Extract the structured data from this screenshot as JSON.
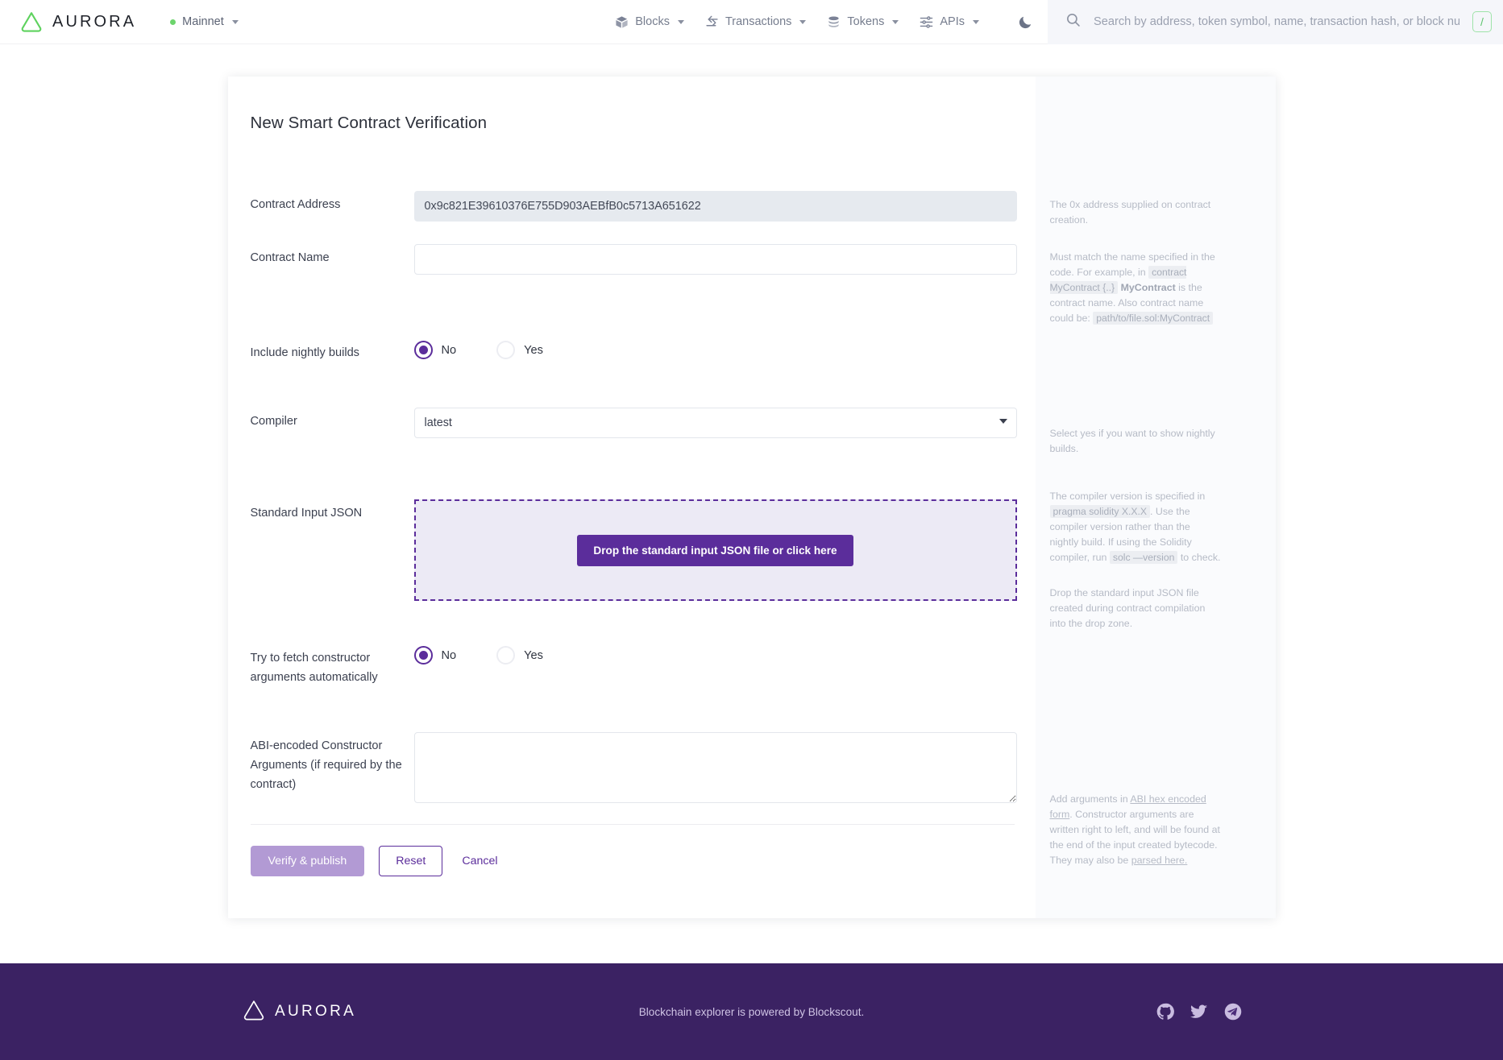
{
  "header": {
    "brand_name": "AURORA",
    "network": {
      "label": "Mainnet",
      "status_color": "#6cd46c"
    },
    "nav": [
      {
        "label": "Blocks",
        "icon": "cube-icon"
      },
      {
        "label": "Transactions",
        "icon": "transfer-arrows-icon"
      },
      {
        "label": "Tokens",
        "icon": "coins-icon"
      },
      {
        "label": "APIs",
        "icon": "sliders-icon"
      }
    ],
    "theme_toggle_icon": "moon-icon",
    "search": {
      "icon": "search-icon",
      "value": "",
      "placeholder": "Search by address, token symbol, name, transaction hash, or block number",
      "shortcut_key": "/"
    }
  },
  "form": {
    "title": "New Smart Contract Verification",
    "contract_address": {
      "label": "Contract Address",
      "value": "0x9c821E39610376E755D903AEBfB0c5713A651622",
      "placeholder": ""
    },
    "contract_name": {
      "label": "Contract Name",
      "value": "",
      "placeholder": ""
    },
    "nightly_builds": {
      "label": "Include nightly builds",
      "options": [
        "No",
        "Yes"
      ],
      "selected": "No"
    },
    "compiler": {
      "label": "Compiler",
      "selected": "latest",
      "options": [
        "latest"
      ]
    },
    "standard_input_json": {
      "label": "Standard Input JSON",
      "drop_button_label": "Drop the standard input JSON file or click here"
    },
    "fetch_constructor_args": {
      "label": "Try to fetch constructor arguments automatically",
      "options": [
        "No",
        "Yes"
      ],
      "selected": "No"
    },
    "constructor_arguments": {
      "label": "ABI-encoded Constructor Arguments (if required by the contract)",
      "value": "",
      "placeholder": ""
    },
    "actions": {
      "submit_label": "Verify & publish",
      "reset_label": "Reset",
      "cancel_label": "Cancel"
    }
  },
  "help": {
    "contract_address": "The 0x address supplied on contract creation.",
    "contract_name_1": "Must match the name specified in the code. For example, in ",
    "contract_name_code_1": "contract MyContract {..}",
    "contract_name_bold": "MyContract",
    "contract_name_2": " is the contract name. Also contract name could be:",
    "contract_name_code_2": "path/to/file.sol:MyContract",
    "nightly_builds": "Select yes if you want to show nightly builds.",
    "compiler_1": "The compiler version is specified in ",
    "compiler_code_1": "pragma solidity X.X.X",
    "compiler_2": ". Use the compiler version rather than the nightly build. If using the Solidity compiler, run ",
    "compiler_code_2": "solc —version",
    "compiler_3": " to check.",
    "standard_input_json": "Drop the standard input JSON file created during contract compilation into the drop zone.",
    "constructor_1": "Add arguments in ",
    "constructor_link_1": "ABI hex encoded form",
    "constructor_2": ". Constructor arguments are written right to left, and will be found at the end of the input created bytecode. They may also be ",
    "constructor_link_2": "parsed here."
  },
  "footer": {
    "brand_name": "AURORA",
    "note": "Blockchain explorer is powered by Blockscout.",
    "social": [
      {
        "name": "github-icon"
      },
      {
        "name": "twitter-icon"
      },
      {
        "name": "telegram-icon"
      }
    ]
  },
  "colors": {
    "brand_green": "#6cd46c",
    "accent_purple": "#5b2d9b",
    "footer_bg": "#3b2263",
    "primary_disabled": "#b29ad4"
  }
}
